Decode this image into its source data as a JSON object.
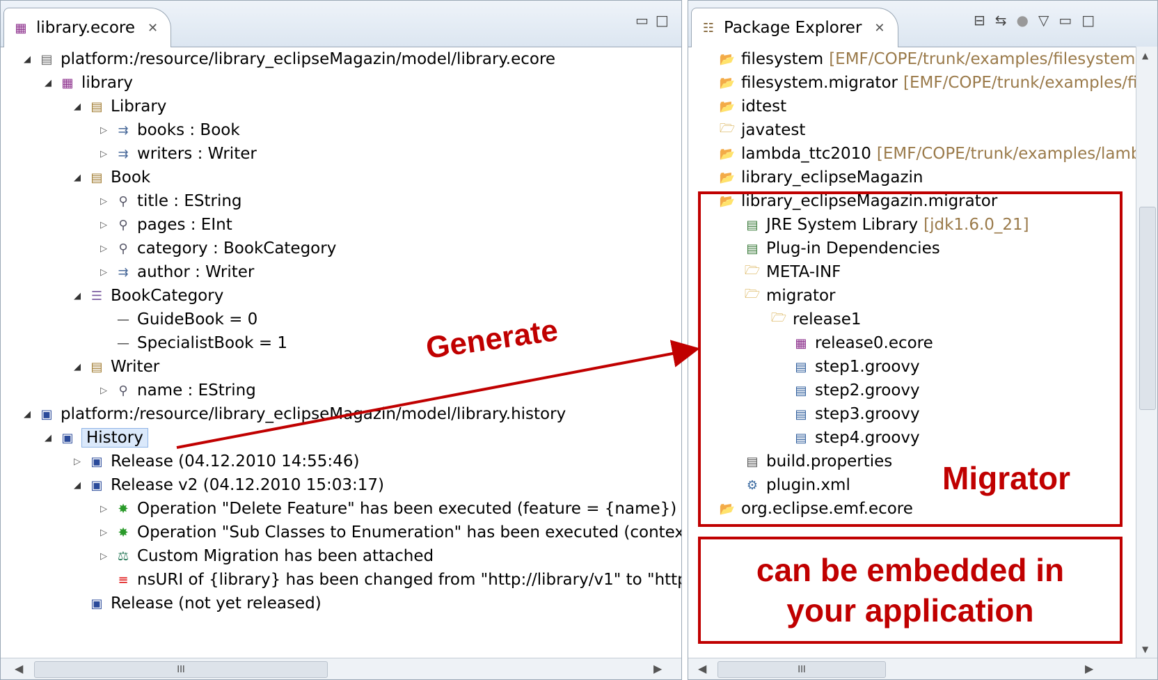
{
  "left_panel": {
    "tab_title": "library.ecore",
    "tree": [
      {
        "text": "platform:/resource/library_eclipseMagazin/model/library.ecore",
        "icon": "file-icon"
      },
      {
        "text": "library",
        "icon": "package-icon"
      },
      {
        "text": "Library",
        "icon": "class-icon"
      },
      {
        "text": "books : Book",
        "icon": "reference-icon"
      },
      {
        "text": "writers : Writer",
        "icon": "reference-icon"
      },
      {
        "text": "Book",
        "icon": "class-icon"
      },
      {
        "text": "title : EString",
        "icon": "attribute-icon"
      },
      {
        "text": "pages : EInt",
        "icon": "attribute-icon"
      },
      {
        "text": "category : BookCategory",
        "icon": "attribute-icon"
      },
      {
        "text": "author : Writer",
        "icon": "reference-icon"
      },
      {
        "text": "BookCategory",
        "icon": "enum-icon"
      },
      {
        "text": "GuideBook = 0",
        "icon": "literal-icon"
      },
      {
        "text": "SpecialistBook = 1",
        "icon": "literal-icon"
      },
      {
        "text": "Writer",
        "icon": "class-icon"
      },
      {
        "text": "name : EString",
        "icon": "attribute-icon"
      },
      {
        "text": "platform:/resource/library_eclipseMagazin/model/library.history",
        "icon": "history-file-icon"
      },
      {
        "text": "History",
        "icon": "history-icon"
      },
      {
        "text": "Release (04.12.2010 14:55:46)",
        "icon": "release-icon"
      },
      {
        "text": "Release v2 (04.12.2010 15:03:17)",
        "icon": "release-icon"
      },
      {
        "text": "Operation \"Delete Feature\" has been executed (feature = {name})",
        "icon": "operation-icon"
      },
      {
        "text": "Operation \"Sub Classes to Enumeration\" has been executed (contextClas:",
        "icon": "operation-icon"
      },
      {
        "text": "Custom Migration has been attached",
        "icon": "custom-migration-icon"
      },
      {
        "text": "nsURI of {library} has been changed from \"http://library/v1\" to \"http://lib",
        "icon": "change-icon"
      },
      {
        "text": "Release (not yet released)",
        "icon": "release-icon"
      }
    ]
  },
  "right_panel": {
    "tab_title": "Package Explorer",
    "tree": [
      {
        "text": "filesystem",
        "suffix": "[EMF/COPE/trunk/examples/filesystem]",
        "icon": "project-icon"
      },
      {
        "text": "filesystem.migrator",
        "suffix": "[EMF/COPE/trunk/examples/file",
        "icon": "project-icon"
      },
      {
        "text": "idtest",
        "suffix": "",
        "icon": "project-icon"
      },
      {
        "text": "javatest",
        "suffix": "",
        "icon": "folder-icon"
      },
      {
        "text": "lambda_ttc2010",
        "suffix": "[EMF/COPE/trunk/examples/lambd",
        "icon": "project-icon"
      },
      {
        "text": "library_eclipseMagazin",
        "suffix": "",
        "icon": "project-icon"
      },
      {
        "text": "library_eclipseMagazin.migrator",
        "suffix": "",
        "icon": "project-icon"
      },
      {
        "text": "JRE System Library",
        "suffix": "[jdk1.6.0_21]",
        "icon": "library-icon"
      },
      {
        "text": "Plug-in Dependencies",
        "suffix": "",
        "icon": "library-icon"
      },
      {
        "text": "META-INF",
        "suffix": "",
        "icon": "folder-icon"
      },
      {
        "text": "migrator",
        "suffix": "",
        "icon": "folder-icon"
      },
      {
        "text": "release1",
        "suffix": "",
        "icon": "folder-icon"
      },
      {
        "text": "release0.ecore",
        "suffix": "",
        "icon": "ecore-file-icon"
      },
      {
        "text": "step1.groovy",
        "suffix": "",
        "icon": "groovy-file-icon"
      },
      {
        "text": "step2.groovy",
        "suffix": "",
        "icon": "groovy-file-icon"
      },
      {
        "text": "step3.groovy",
        "suffix": "",
        "icon": "groovy-file-icon"
      },
      {
        "text": "step4.groovy",
        "suffix": "",
        "icon": "groovy-file-icon"
      },
      {
        "text": "build.properties",
        "suffix": "",
        "icon": "properties-file-icon"
      },
      {
        "text": "plugin.xml",
        "suffix": "",
        "icon": "plugin-file-icon"
      },
      {
        "text": "org.eclipse.emf.ecore",
        "suffix": "",
        "icon": "project-icon"
      }
    ]
  },
  "annotations": {
    "generate": "Generate",
    "migrator": "Migrator",
    "embedded_line1": "can be embedded in",
    "embedded_line2": "your application"
  },
  "colors": {
    "annotation": "#c00000",
    "decorator": "#9a7a4a"
  }
}
